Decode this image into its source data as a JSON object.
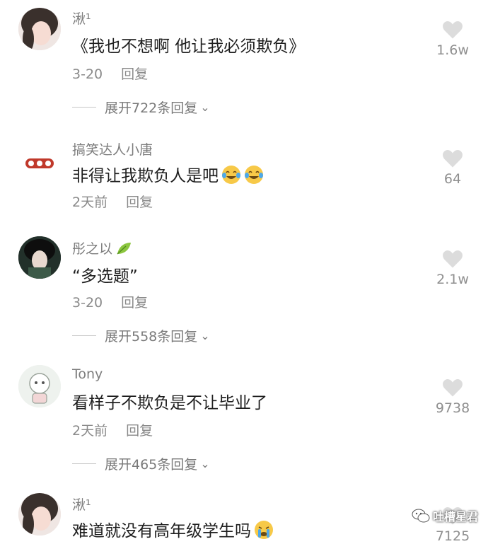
{
  "comments": [
    {
      "username": "湫¹",
      "text": "《我也不想啊 他让我必须欺负》",
      "date": "3-20",
      "reply_label": "回复",
      "expand_label": "展开722条回复",
      "likes": "1.6w"
    },
    {
      "username": "搞笑达人小唐",
      "text": "非得让我欺负人是吧",
      "date": "2天前",
      "reply_label": "回复",
      "likes": "64"
    },
    {
      "username": "彤之以",
      "text": "“多选题”",
      "date": "3-20",
      "reply_label": "回复",
      "expand_label": "展开558条回复",
      "likes": "2.1w"
    },
    {
      "username": "Tony",
      "text": "看样子不欺负是不让毕业了",
      "date": "2天前",
      "reply_label": "回复",
      "expand_label": "展开465条回复",
      "likes": "9738"
    },
    {
      "username": "湫¹",
      "text": "难道就没有高年级学生吗",
      "likes": "7125"
    }
  ],
  "watermark": "吐槽星君",
  "icons": {
    "like": "heart-icon",
    "expand": "chevron-down-icon",
    "emoji_laugh": "laughing-crying-emoji",
    "emoji_cry": "crying-emoji",
    "badge": "leaf-badge-icon",
    "watermark": "wechat-icon"
  },
  "colors": {
    "username": "#7d7d7d",
    "text": "#1e1e1e",
    "meta": "#8a8a8a",
    "heart": "#dcdcdc"
  }
}
